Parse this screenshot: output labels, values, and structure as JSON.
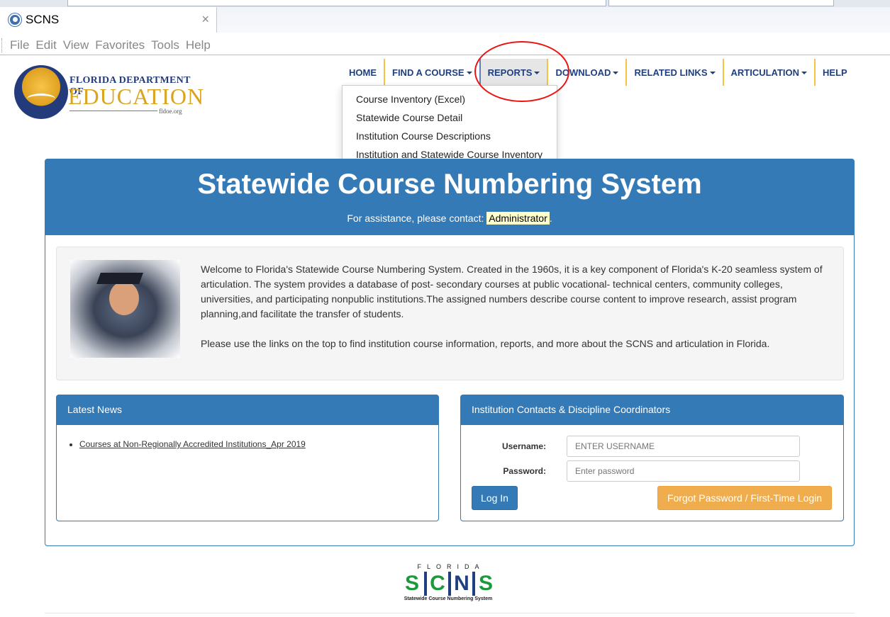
{
  "browser": {
    "tab_title": "SCNS",
    "close_glyph": "×",
    "menu": [
      "File",
      "Edit",
      "View",
      "Favorites",
      "Tools",
      "Help"
    ]
  },
  "logo": {
    "line1": "FLORIDA DEPARTMENT OF",
    "line2": "EDUCATION",
    "line3": "fldoe.org"
  },
  "nav": {
    "items": [
      {
        "label": "HOME",
        "caret": false
      },
      {
        "label": "FIND A COURSE",
        "caret": true
      },
      {
        "label": "REPORTS",
        "caret": true
      },
      {
        "label": "DOWNLOAD",
        "caret": true
      },
      {
        "label": "RELATED LINKS",
        "caret": true
      },
      {
        "label": "ARTICULATION",
        "caret": true
      },
      {
        "label": "HELP",
        "caret": false
      }
    ],
    "active": "REPORTS"
  },
  "reports_menu": [
    "Course Inventory (Excel)",
    "Statewide Course Detail",
    "Institution Course Descriptions",
    "Institution and Statewide Course Inventory"
  ],
  "hero": {
    "title": "Statewide Course Numbering System",
    "assist_prefix": "For assistance, please contact:",
    "admin_link": "Administrator",
    "assist_suffix": "."
  },
  "welcome": {
    "para1": "Welcome to Florida's Statewide Course Numbering System. Created in the 1960s, it is a key component of Florida's K-20 seamless system of articulation. The system provides a database of post- secondary courses at public vocational- technical centers, community colleges, universities, and participating nonpublic institutions.The assigned numbers describe course content to improve research, assist program planning,and facilitate the transfer of students.",
    "para2": "Please use the links on the top to find institution course information, reports, and more about the SCNS and articulation in Florida."
  },
  "news": {
    "header": "Latest News",
    "items": [
      "Courses at Non-Regionally Accredited Institutions_Apr 2019"
    ]
  },
  "login": {
    "header": "Institution Contacts & Discipline Coordinators",
    "username_label": "Username:",
    "username_placeholder": "ENTER USERNAME",
    "password_label": "Password:",
    "password_placeholder": "Enter password",
    "login_button": "Log In",
    "forgot_button": "Forgot Password / First-Time Login"
  },
  "footer": {
    "sup": "FLORIDA",
    "letters": [
      "S",
      "C",
      "N",
      "S"
    ],
    "tagline": "Statewide Course Numbering System"
  },
  "colors": {
    "primary": "#337ab7",
    "warning": "#f0ad4e",
    "nav_text": "#1f3f7f",
    "nav_divider": "#f5c242",
    "annotation": "#ee1111"
  }
}
